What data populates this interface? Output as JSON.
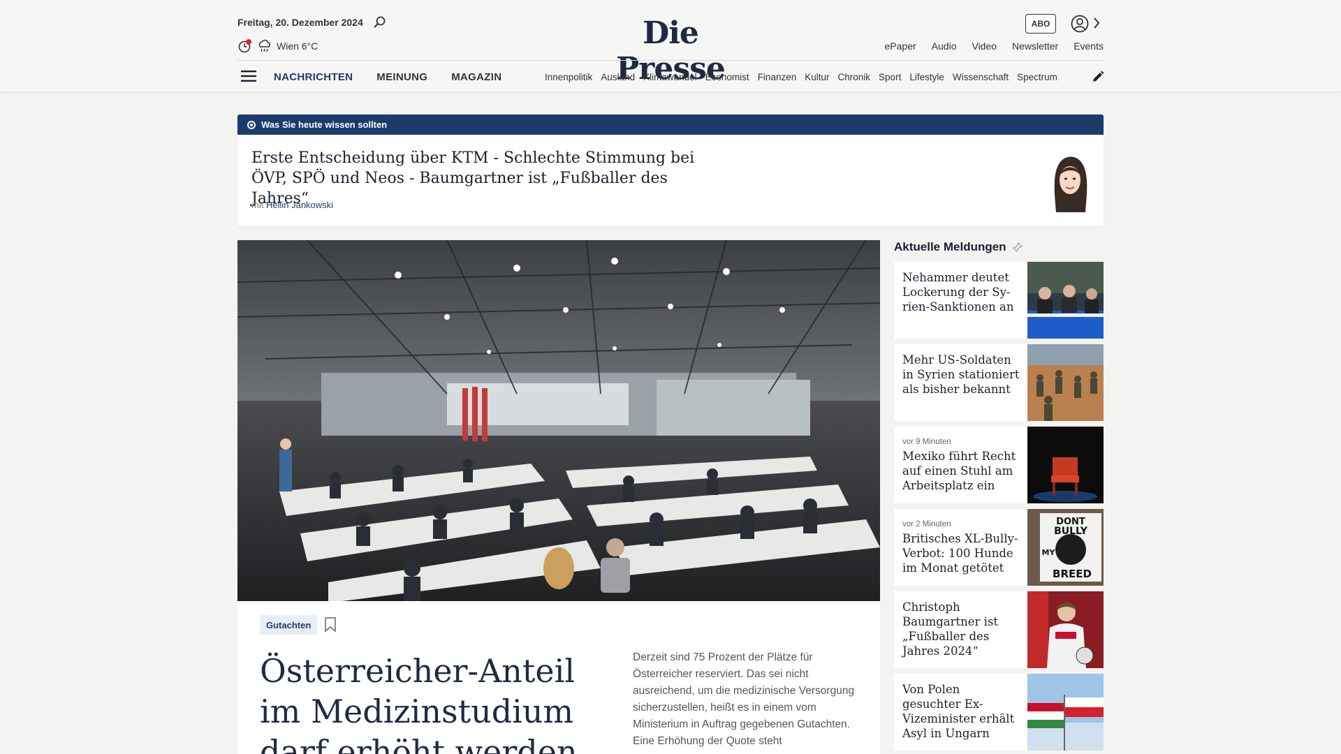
{
  "header": {
    "date": "Freitag, 20. Dezember 2024",
    "weather": "Wien 6°C",
    "logo": "Die Presse",
    "abo_label": "ABO",
    "top_links": [
      "ePaper",
      "Audio",
      "Video",
      "Newsletter",
      "Events"
    ],
    "main_nav": [
      "NACHRICHTEN",
      "MEINUNG",
      "MAGAZIN"
    ],
    "sub_nav": [
      "Innenpolitik",
      "Ausland",
      "Klimawandel",
      "Economist",
      "Finanzen",
      "Kultur",
      "Chronik",
      "Sport",
      "Lifestyle",
      "Wissenschaft",
      "Spectrum"
    ]
  },
  "briefing": {
    "bar_label": "Was Sie heute wissen sollten",
    "title_line1": "Erste Entscheidung über KTM - Schlechte Stimmung bei",
    "title_line2": "ÖVP, SPÖ und Neos - Baumgartner ist „Fußballer des Jahres“",
    "by_prefix": "mit",
    "author": "Hellin Jankowski"
  },
  "lead": {
    "tag": "Gutachten",
    "title": "Österreicher-Anteil im Medizinstudium darf erhöht werden",
    "teaser": "Derzeit sind 75 Prozent der Plätze für Österreicher reserviert. Das sei nicht ausreichend, um die medizinische Versorgung sicherzustellen, heißt es in einem vom Ministerium in Auftrag gegebenen Gutachten. Eine Erhöhung der Quote steht"
  },
  "sidebar": {
    "heading": "Aktuelle Meldungen",
    "items": [
      {
        "time": "",
        "title": "Nehammer deutet Lockerung der Sy-rien-Sanktionen an"
      },
      {
        "time": "",
        "title": "Mehr US-Soldaten in Syrien stationiert als bisher bekannt"
      },
      {
        "time": "vor 9 Minuten",
        "title": "Mexiko führt Recht auf einen Stuhl am Arbeitsplatz ein"
      },
      {
        "time": "vor 2 Minuten",
        "title": "Britisches XL-Bully-Verbot: 100 Hunde im Monat getötet"
      },
      {
        "time": "",
        "title": "Christoph Baumgartner ist „Fußballer des Jahres 2024“"
      },
      {
        "time": "",
        "title": "Von Polen gesuchter Ex-Vizeminister erhält Asyl in Ungarn"
      }
    ],
    "thumb_texts": [
      "DONT",
      "BULLY",
      "MY",
      "BREED"
    ]
  },
  "colors": {
    "brand_blue": "#1e3a6b",
    "live_red": "#e0262b"
  }
}
